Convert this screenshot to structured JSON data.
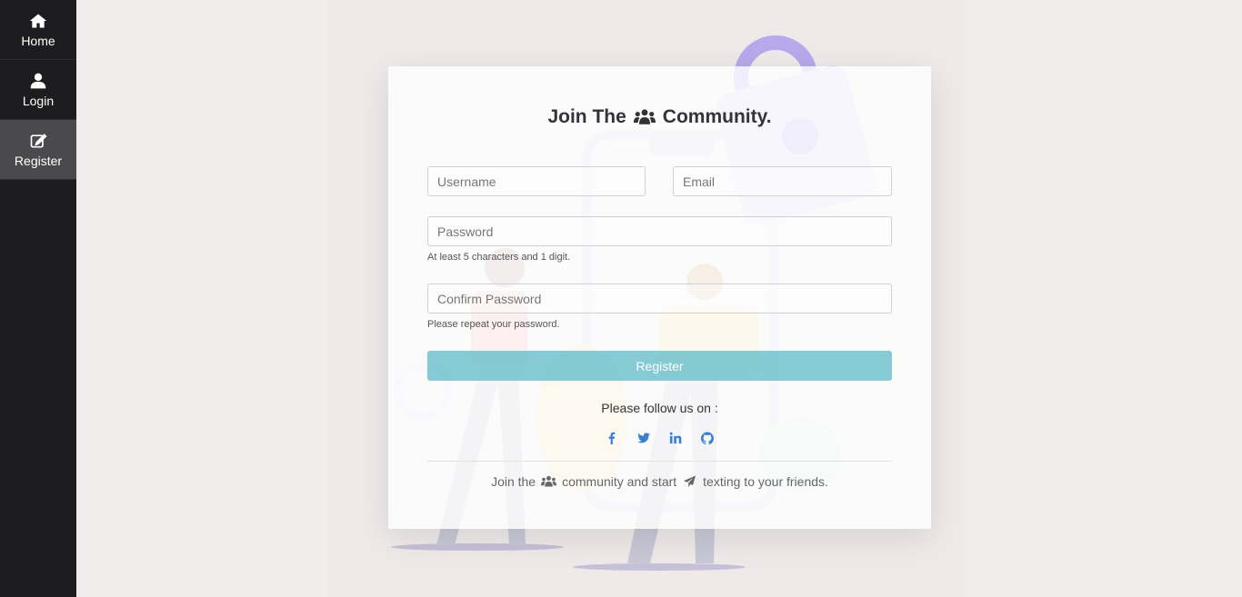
{
  "sidebar": {
    "items": [
      {
        "label": "Home",
        "icon": "home-icon"
      },
      {
        "label": "Login",
        "icon": "user-icon"
      },
      {
        "label": "Register",
        "icon": "edit-icon",
        "active": true
      }
    ]
  },
  "form": {
    "title_prefix": "Join The",
    "title_suffix": "Community.",
    "username_placeholder": "Username",
    "email_placeholder": "Email",
    "password_placeholder": "Password",
    "password_hint": "At least 5 characters and 1 digit.",
    "confirm_placeholder": "Confirm Password",
    "confirm_hint": "Please repeat your password.",
    "register_label": "Register"
  },
  "social": {
    "follow_text": "Please follow us on :",
    "icons": [
      "facebook-icon",
      "twitter-icon",
      "linkedin-icon",
      "github-icon"
    ]
  },
  "footer": {
    "part1": "Join the",
    "part2": "community and start",
    "part3": "texting to your friends."
  },
  "colors": {
    "sidebar_bg": "#1d1d1f",
    "active_bg": "#4a4a4c",
    "accent": "#70c1cc",
    "social": "#3b7fd1"
  }
}
